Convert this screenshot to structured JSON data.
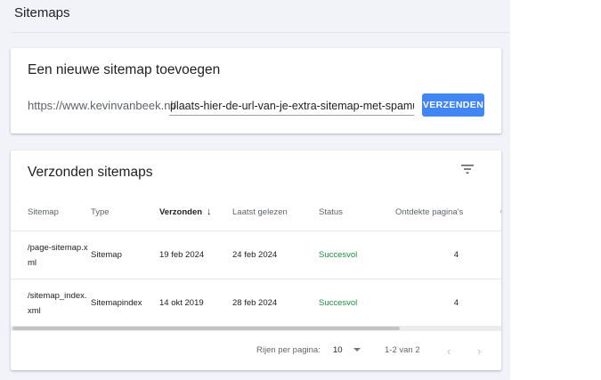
{
  "page": {
    "title": "Sitemaps"
  },
  "add_card": {
    "title": "Een nieuwe sitemap toevoegen",
    "url_prefix": "https://www.kevinvanbeek.nl/",
    "input_value": "plaats-hier-de-url-van-je-extra-sitemap-met-spamurl",
    "submit_label": "VERZENDEN"
  },
  "list_card": {
    "title": "Verzonden sitemaps",
    "columns": [
      "Sitemap",
      "Type",
      "Verzonden",
      "Laatst gelezen",
      "Status",
      "Ontdekte pagina's",
      "Or"
    ],
    "sort_arrow": "↓",
    "rows": [
      {
        "sitemap": "/page-sitemap.xml",
        "type": "Sitemap",
        "submitted": "19 feb 2024",
        "last_read": "24 feb 2024",
        "status": "Succesvol",
        "discovered": "4"
      },
      {
        "sitemap": "/sitemap_index.xml",
        "type": "Sitemapindex",
        "submitted": "14 okt 2019",
        "last_read": "28 feb 2024",
        "status": "Succesvol",
        "discovered": "4"
      }
    ],
    "pagination": {
      "rows_per_page_label": "Rijen per pagina:",
      "rows_per_page": "10",
      "range": "1-2 van 2",
      "prev": "‹",
      "next": "›"
    }
  },
  "colors": {
    "accent": "#4285f4",
    "success": "#1e8e3e",
    "background": "#f1f3f9"
  },
  "icons": {
    "filter": "filter-icon",
    "sort_arrow": "arrow-down-icon",
    "dropdown": "caret-down-icon"
  }
}
